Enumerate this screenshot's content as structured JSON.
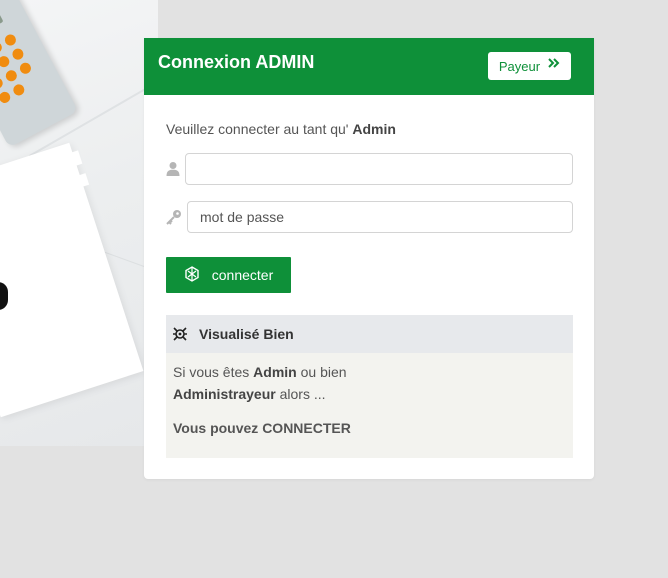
{
  "header": {
    "title": "Connexion ADMIN",
    "payeur_label": "Payeur",
    "accent_color": "#0e9039"
  },
  "form": {
    "intro_text": "Veuillez connecter au tant qu' ",
    "intro_bold": "Admin",
    "username_value": "",
    "password_placeholder": "mot de passe",
    "submit_label": "connecter",
    "icons": [
      "user-icon",
      "key-icon",
      "submit-icon"
    ]
  },
  "info": {
    "title": "Visualisé Bien",
    "line1_pre": "Si vous êtes ",
    "line1_bold": "Admin",
    "line1_post": " ou bien",
    "line2_bold": "Administrayeur",
    "line2_post": " alors ...",
    "line3": "Vous pouvez CONNECTER"
  }
}
